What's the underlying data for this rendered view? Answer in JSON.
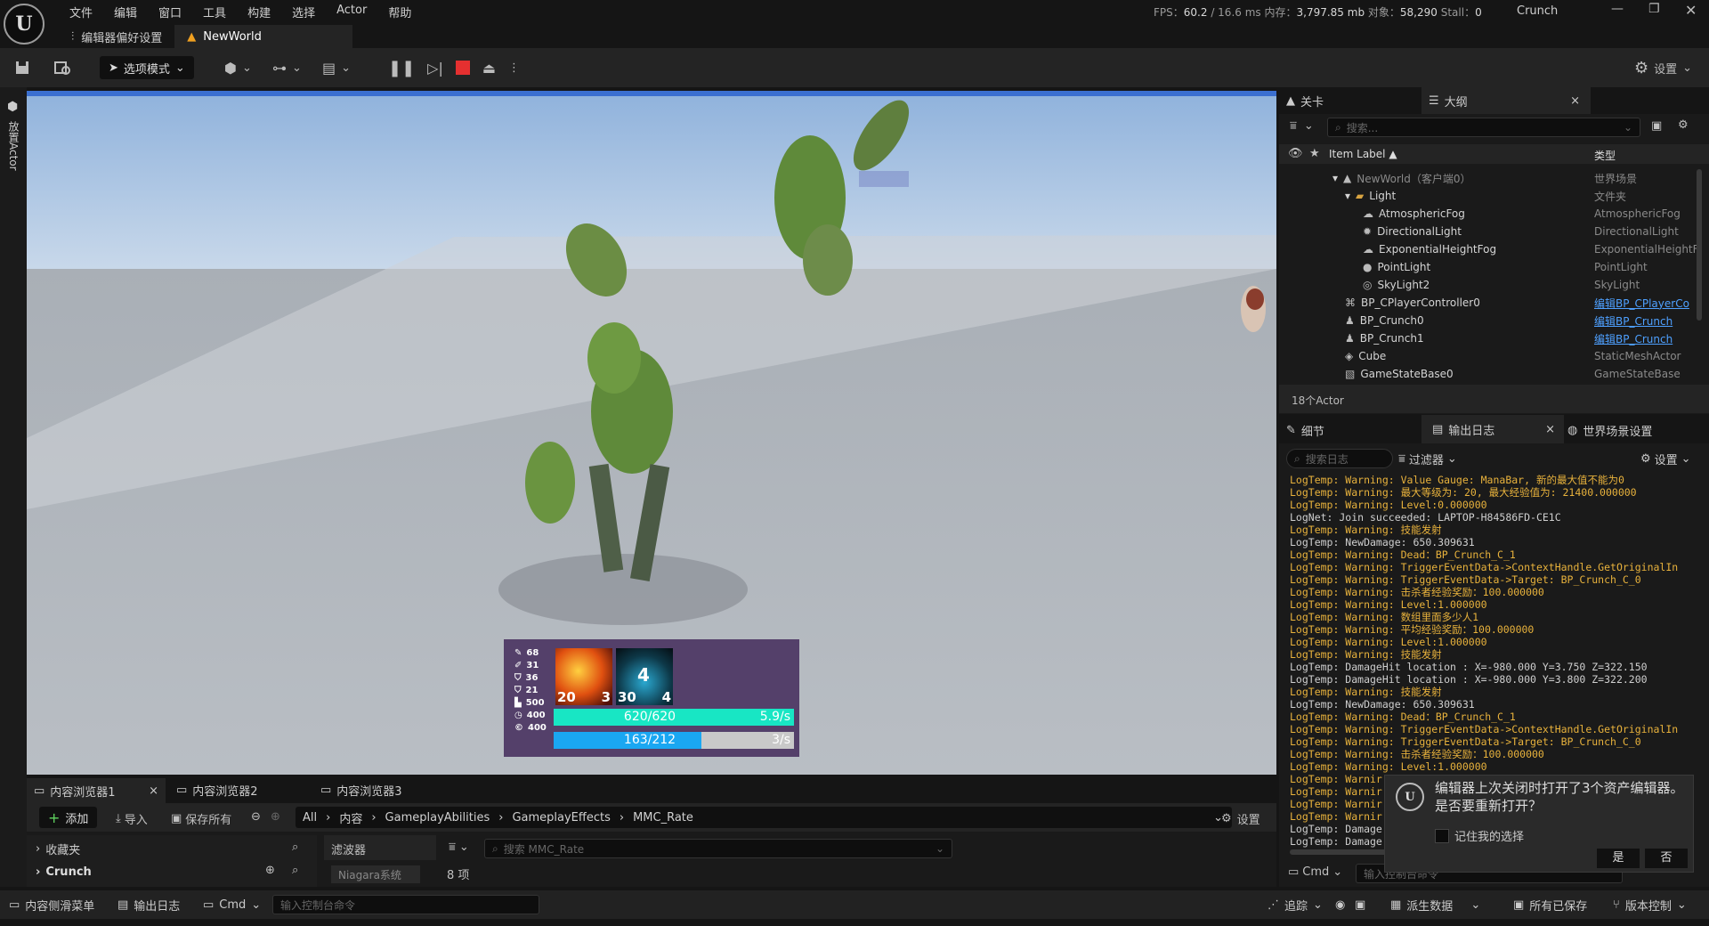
{
  "menu": [
    "文件",
    "编辑",
    "窗口",
    "工具",
    "构建",
    "选择",
    "Actor",
    "帮助"
  ],
  "stats": {
    "fps_label": "FPS：",
    "fps": "60.2",
    "ms": "/ 16.6 ms",
    "mem_label": "内存：",
    "mem": "3,797.85 mb",
    "obj_label": "对象：",
    "obj": "58,290",
    "stall_label": "Stall：",
    "stall": "0"
  },
  "project": "Crunch",
  "tabs": {
    "prefs": "编辑器偏好设置",
    "world": "NewWorld"
  },
  "toolbar": {
    "mode": "选项模式",
    "settings": "设置"
  },
  "left_strip": "放置Actor",
  "hud": {
    "stats": [
      {
        "icon": "sword",
        "value": "68"
      },
      {
        "icon": "dagger",
        "value": "31"
      },
      {
        "icon": "shield",
        "value": "36"
      },
      {
        "icon": "armor",
        "value": "21"
      },
      {
        "icon": "boot",
        "value": "500"
      },
      {
        "icon": "clock",
        "value": "400"
      },
      {
        "icon": "copyright",
        "value": "400"
      }
    ],
    "skill1": {
      "left": "20",
      "right": "3"
    },
    "skill2": {
      "top": "4",
      "left": "30",
      "right": "4"
    },
    "health": {
      "text": "620/620",
      "rate": "5.9/s",
      "fill": 1.0,
      "color": "#18e6c4"
    },
    "mana": {
      "text": "163/212",
      "rate": "3/s",
      "fill": 0.77,
      "color": "#1aa7f2"
    }
  },
  "outliner": {
    "tab_level": "关卡",
    "tab_outliner": "大纲",
    "search": "搜索...",
    "col_label": "Item Label",
    "col_type": "类型",
    "rows": [
      {
        "label": "NewWorld（客户端0）",
        "type": "世界场景",
        "indent": 0,
        "icon": "world",
        "link": false
      },
      {
        "label": "Light",
        "type": "文件夹",
        "indent": 1,
        "icon": "folder",
        "link": false
      },
      {
        "label": "AtmosphericFog",
        "type": "AtmosphericFog",
        "indent": 2,
        "icon": "fog",
        "link": false
      },
      {
        "label": "DirectionalLight",
        "type": "DirectionalLight",
        "indent": 2,
        "icon": "sun",
        "link": false
      },
      {
        "label": "ExponentialHeightFog",
        "type": "ExponentialHeightF",
        "indent": 2,
        "icon": "fog",
        "link": false
      },
      {
        "label": "PointLight",
        "type": "PointLight",
        "indent": 2,
        "icon": "bulb",
        "link": false
      },
      {
        "label": "SkyLight2",
        "type": "SkyLight",
        "indent": 2,
        "icon": "sky",
        "link": false
      },
      {
        "label": "BP_CPlayerController0",
        "type": "编辑BP_CPlayerCo",
        "indent": 1,
        "icon": "gamepad",
        "link": true
      },
      {
        "label": "BP_Crunch0",
        "type": "编辑BP_Crunch",
        "indent": 1,
        "icon": "pawn",
        "link": true
      },
      {
        "label": "BP_Crunch1",
        "type": "编辑BP_Crunch",
        "indent": 1,
        "icon": "pawn",
        "link": true
      },
      {
        "label": "Cube",
        "type": "StaticMeshActor",
        "indent": 1,
        "icon": "cube",
        "link": false
      },
      {
        "label": "GameStateBase0",
        "type": "GameStateBase",
        "indent": 1,
        "icon": "state",
        "link": false
      }
    ],
    "count": "18个Actor"
  },
  "details": {
    "tab_details": "细节",
    "tab_log": "输出日志",
    "tab_world": "世界场景设置",
    "search": "搜索日志",
    "filter": "过滤器",
    "settings": "设置",
    "cmd": "Cmd",
    "cmd_placeholder": "输入控制台命令"
  },
  "log": [
    {
      "t": "LogTemp: Warning: Value Gauge: ManaBar, 新的最大值不能为0",
      "w": true
    },
    {
      "t": "LogTemp: Warning: 最大等级为: 20, 最大经验值为: 21400.000000",
      "w": true
    },
    {
      "t": "LogTemp: Warning: Level:0.000000",
      "w": true
    },
    {
      "t": "LogNet: Join succeeded: LAPTOP-H84586FD-CE1C",
      "w": false
    },
    {
      "t": "LogTemp: Warning: 技能发射",
      "w": true
    },
    {
      "t": "LogTemp: NewDamage: 650.309631",
      "w": false
    },
    {
      "t": "LogTemp: Warning: Dead：BP_Crunch_C_1",
      "w": true
    },
    {
      "t": "LogTemp: Warning: TriggerEventData->ContextHandle.GetOriginalIn",
      "w": true
    },
    {
      "t": "LogTemp: Warning: TriggerEventData->Target: BP_Crunch_C_0",
      "w": true
    },
    {
      "t": "LogTemp: Warning: 击杀者经验奖励：100.000000",
      "w": true
    },
    {
      "t": "LogTemp: Warning: Level:1.000000",
      "w": true
    },
    {
      "t": "LogTemp: Warning: 数组里面多少人1",
      "w": true
    },
    {
      "t": "LogTemp: Warning: 平均经验奖励：100.000000",
      "w": true
    },
    {
      "t": "LogTemp: Warning: Level:1.000000",
      "w": true
    },
    {
      "t": "LogTemp: Warning: 技能发射",
      "w": true
    },
    {
      "t": "LogTemp: DamageHit location : X=-980.000 Y=3.750 Z=322.150",
      "w": false
    },
    {
      "t": "LogTemp: DamageHit location : X=-980.000 Y=3.800 Z=322.200",
      "w": false
    },
    {
      "t": "LogTemp: Warning: 技能发射",
      "w": true
    },
    {
      "t": "LogTemp: NewDamage: 650.309631",
      "w": false
    },
    {
      "t": "LogTemp: Warning: Dead：BP_Crunch_C_1",
      "w": true
    },
    {
      "t": "LogTemp: Warning: TriggerEventData->ContextHandle.GetOriginalIn",
      "w": true
    },
    {
      "t": "LogTemp: Warning: TriggerEventData->Target: BP_Crunch_C_0",
      "w": true
    },
    {
      "t": "LogTemp: Warning: 击杀者经验奖励：100.000000",
      "w": true
    },
    {
      "t": "LogTemp: Warning: Level:1.000000",
      "w": true
    },
    {
      "t": "LogTemp: Warnir",
      "w": true
    },
    {
      "t": "LogTemp: Warnir",
      "w": true
    },
    {
      "t": "LogTemp: Warnir",
      "w": true
    },
    {
      "t": "LogTemp: Warnir",
      "w": true
    },
    {
      "t": "LogTemp: Damage",
      "w": false
    },
    {
      "t": "LogTemp: Damage",
      "w": false
    }
  ],
  "dialog": {
    "message": "编辑器上次关闭时打开了3个资产编辑器。是否要重新打开？",
    "remember": "记住我的选择",
    "yes": "是",
    "no": "否"
  },
  "content": {
    "tabs": [
      "内容浏览器1",
      "内容浏览器2",
      "内容浏览器3"
    ],
    "add": "添加",
    "import": "导入",
    "save_all": "保存所有",
    "crumbs": [
      "All",
      "内容",
      "GameplayAbilities",
      "GameplayEffects",
      "MMC_Rate"
    ],
    "settings": "设置",
    "favorites": "收藏夹",
    "project": "Crunch",
    "filters": "滤波器",
    "niagara": "Niagara系统",
    "search": "搜索 MMC_Rate",
    "count": "8 项"
  },
  "status": {
    "drawer": "内容侧滑菜单",
    "log": "输出日志",
    "cmd": "Cmd",
    "cmd_placeholder": "输入控制台命令",
    "trace": "追踪",
    "derived": "派生数据",
    "saved": "所有已保存",
    "vcs": "版本控制"
  }
}
